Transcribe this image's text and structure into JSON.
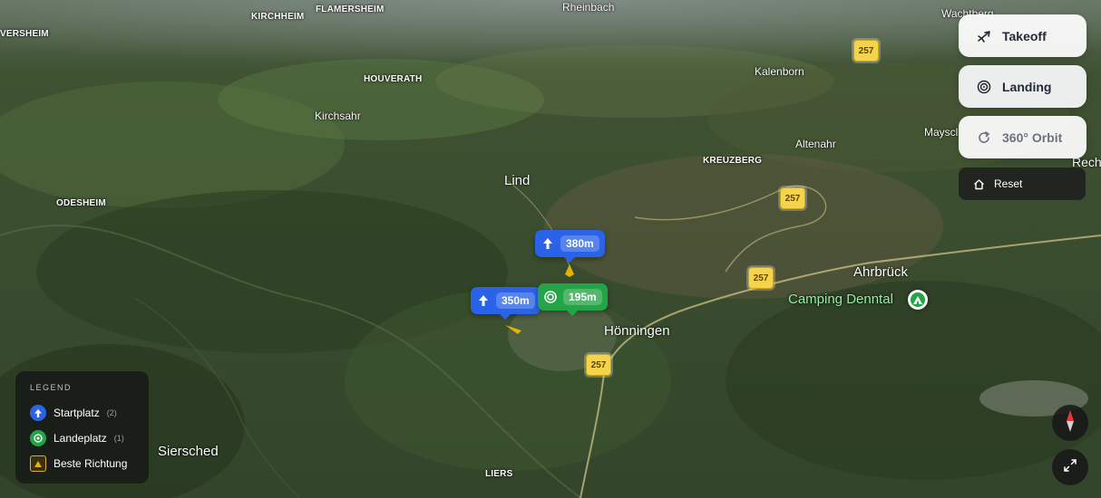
{
  "map": {
    "places": [
      {
        "name": "KIRCHHEIM"
      },
      {
        "name": "FLAMERSHEIM"
      },
      {
        "name": "Rheinbach"
      },
      {
        "name": "Wachtberg"
      },
      {
        "name": "VERSHEIM"
      },
      {
        "name": "HOUVERATH"
      },
      {
        "name": "Kalenborn"
      },
      {
        "name": "Kirchsahr"
      },
      {
        "name": "Mayscl"
      },
      {
        "name": "Altenahr"
      },
      {
        "name": "KREUZBERG"
      },
      {
        "name": "Rech"
      },
      {
        "name": "Lind"
      },
      {
        "name": "ODESHEIM"
      },
      {
        "name": "Ahrbrück"
      },
      {
        "name": "Camping Denntal"
      },
      {
        "name": "Hönningen"
      },
      {
        "name": "Siersched"
      },
      {
        "name": "LIERS"
      }
    ],
    "road_shields": [
      "257",
      "257",
      "257",
      "257"
    ],
    "markers": [
      {
        "type": "takeoff",
        "altitude": "380m",
        "icon": "arrow-up-icon"
      },
      {
        "type": "takeoff",
        "altitude": "350m",
        "icon": "arrow-up-icon"
      },
      {
        "type": "landing",
        "altitude": "195m",
        "icon": "target-icon"
      }
    ],
    "poi_icon": "camping-tent-icon"
  },
  "controls": {
    "takeoff_label": "Takeoff",
    "landing_label": "Landing",
    "orbit_label": "360° Orbit",
    "reset_label": "Reset"
  },
  "legend": {
    "title": "LEGEND",
    "items": [
      {
        "label": "Startplatz",
        "count": "(2)",
        "color": "#2a63e8"
      },
      {
        "label": "Landeplatz",
        "count": "(1)",
        "color": "#23a446"
      },
      {
        "label": "Beste Richtung",
        "count": "",
        "color": "#e5b400"
      }
    ]
  },
  "colors": {
    "takeoff": "#2a63e8",
    "landing": "#23a446",
    "road_shield": "#f5d34a"
  }
}
